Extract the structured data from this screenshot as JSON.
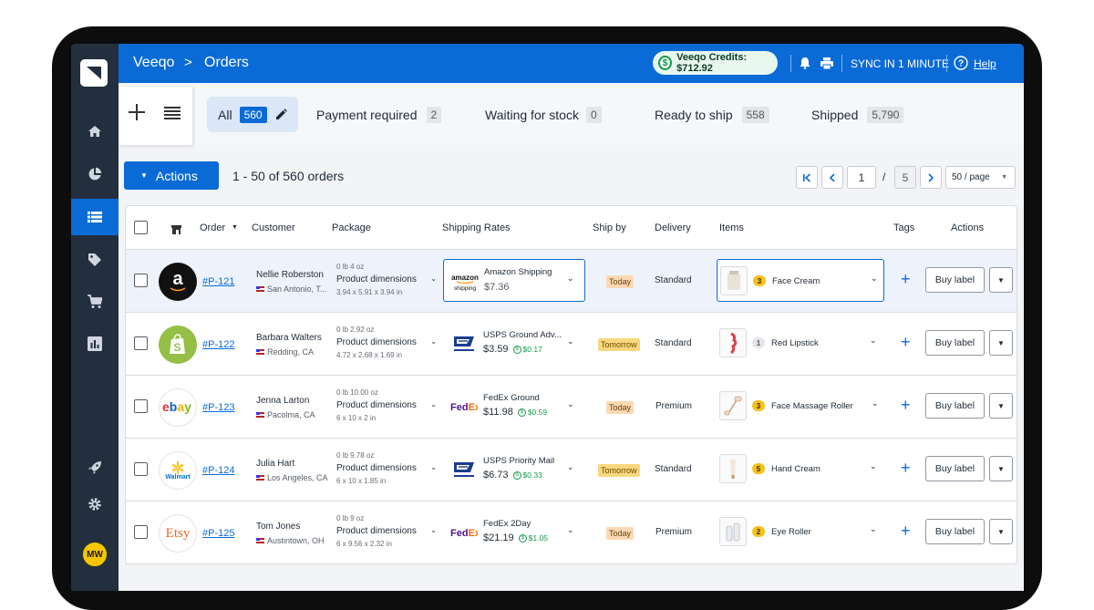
{
  "topbar": {
    "app": "Veeqo",
    "separator": ">",
    "page": "Orders",
    "credits": "Veeqo Credits: $712.92",
    "sync": "SYNC IN 1 MINUTE",
    "help": "Help"
  },
  "sidebar": {
    "avatar": "MW",
    "items": [
      "home-icon",
      "pie-chart-icon",
      "list-icon",
      "tag-icon",
      "cart-icon",
      "bar-chart-icon"
    ],
    "bottom": [
      "rocket-icon",
      "gear-icon"
    ],
    "active": "list-icon"
  },
  "tabs": [
    {
      "label": "All",
      "count": "560"
    },
    {
      "label": "Payment required",
      "count": "2"
    },
    {
      "label": "Waiting for stock",
      "count": "0"
    },
    {
      "label": "Ready to ship",
      "count": "558"
    },
    {
      "label": "Shipped",
      "count": "5,790"
    }
  ],
  "toolbar": {
    "actions": "Actions",
    "range": "1 - 50 of 560 orders",
    "page": "1",
    "page_sep": "/",
    "pages": "5",
    "per_page": "50 / page"
  },
  "columns": {
    "order": "Order",
    "customer": "Customer",
    "package": "Package",
    "rates": "Shipping Rates",
    "shipby": "Ship by",
    "delivery": "Delivery",
    "items": "Items",
    "tags": "Tags",
    "actions": "Actions"
  },
  "rows": [
    {
      "channel": "Amazon",
      "channel_mark": "a",
      "order": "#P-121",
      "customer": "Nellie Roberston",
      "location": "San Antonio, T...",
      "weight": "0 lb 4 oz",
      "dims_label": "Product dimensions",
      "dims": "3.94 x 5.91 x 3.94 in",
      "carrier": "amazon shipping",
      "rate_name": "Amazon Shipping",
      "price": "$7.36",
      "cashback": "",
      "ship_by": "Today",
      "delivery": "Standard",
      "qty": "3",
      "item": "Face Cream",
      "buy": "Buy label"
    },
    {
      "channel": "Shopify",
      "channel_mark": "S",
      "order": "#P-122",
      "customer": "Barbara Walters",
      "location": "Redding, CA",
      "weight": "0 lb 2.92 oz",
      "dims_label": "Product dimensions",
      "dims": "4.72 x 2.68 x 1.69 in",
      "carrier": "USPS",
      "rate_name": "USPS Ground Adv...",
      "price": "$3.59",
      "cashback": "$0.17",
      "ship_by": "Tomorrow",
      "delivery": "Standard",
      "qty": "1",
      "item": "Red Lipstick",
      "buy": "Buy label"
    },
    {
      "channel": "eBay",
      "channel_mark": "ebay",
      "order": "#P-123",
      "customer": "Jenna Larton",
      "location": "Pacolma, CA",
      "weight": "0 lb 10.00 oz",
      "dims_label": "Product dimensions",
      "dims": "6 x 10 x 2 in",
      "carrier": "FedEx",
      "rate_name": "FedEx Ground",
      "price": "$11.98",
      "cashback": "$0.59",
      "ship_by": "Today",
      "delivery": "Premium",
      "qty": "3",
      "item": "Face Massage Roller",
      "buy": "Buy label"
    },
    {
      "channel": "Walmart",
      "channel_mark": "Walmart",
      "order": "#P-124",
      "customer": "Julia Hart",
      "location": "Los Angeles, CA",
      "weight": "0 lb 9.78 oz",
      "dims_label": "Product dimensions",
      "dims": "6 x 10 x 1.85 in",
      "carrier": "USPS",
      "rate_name": "USPS Priority Mail",
      "price": "$6.73",
      "cashback": "$0.33",
      "ship_by": "Tomorrow",
      "delivery": "Standard",
      "qty": "5",
      "item": "Hand Cream",
      "buy": "Buy label"
    },
    {
      "channel": "Etsy",
      "channel_mark": "Etsy",
      "order": "#P-125",
      "customer": "Tom Jones",
      "location": "Austintown, OH",
      "weight": "0 lb 9 oz",
      "dims_label": "Product dimensions",
      "dims": "6 x 9.56 x 2.32 in",
      "carrier": "FedEx",
      "rate_name": "FedEx 2Day",
      "price": "$21.19",
      "cashback": "$1.05",
      "ship_by": "Today",
      "delivery": "Premium",
      "qty": "2",
      "item": "Eye Roller",
      "buy": "Buy label"
    }
  ],
  "colors": {
    "brand": "#0a6bd6",
    "sidebar": "#232f3e",
    "cashback": "#159a4a",
    "today": "#fbd9b5",
    "tomorrow": "#f9d77e"
  }
}
